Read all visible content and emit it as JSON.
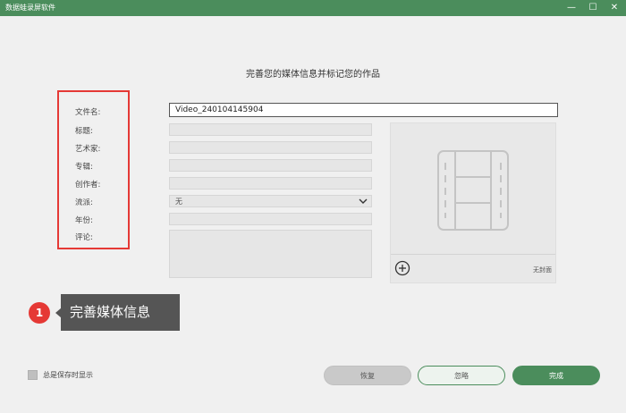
{
  "window": {
    "title": "数据蛙录屏软件",
    "minimize_symbol": "—",
    "maximize_symbol": "☐",
    "close_symbol": "✕"
  },
  "heading": "完善您的媒体信息并标记您的作品",
  "form": {
    "filename_label": "文件名:",
    "filename_value": "Video_240104145904",
    "title_label": "标题:",
    "artist_label": "艺术家:",
    "album_label": "专辑:",
    "creator_label": "创作者:",
    "genre_label": "流派:",
    "genre_value": "无",
    "year_label": "年份:",
    "comment_label": "评论:"
  },
  "cover": {
    "no_cover_text": "无封面",
    "add_icon": "plus-circle-icon"
  },
  "annotation": {
    "step_number": "1",
    "tooltip_text": "完善媒体信息",
    "highlight_color": "#e53935"
  },
  "footer": {
    "always_show_label": "总是保存时显示",
    "always_show_checked": false,
    "restore_label": "恢复",
    "ignore_label": "忽略",
    "done_label": "完成"
  },
  "colors": {
    "accent": "#4b8d5c",
    "background": "#f0f0f0"
  }
}
